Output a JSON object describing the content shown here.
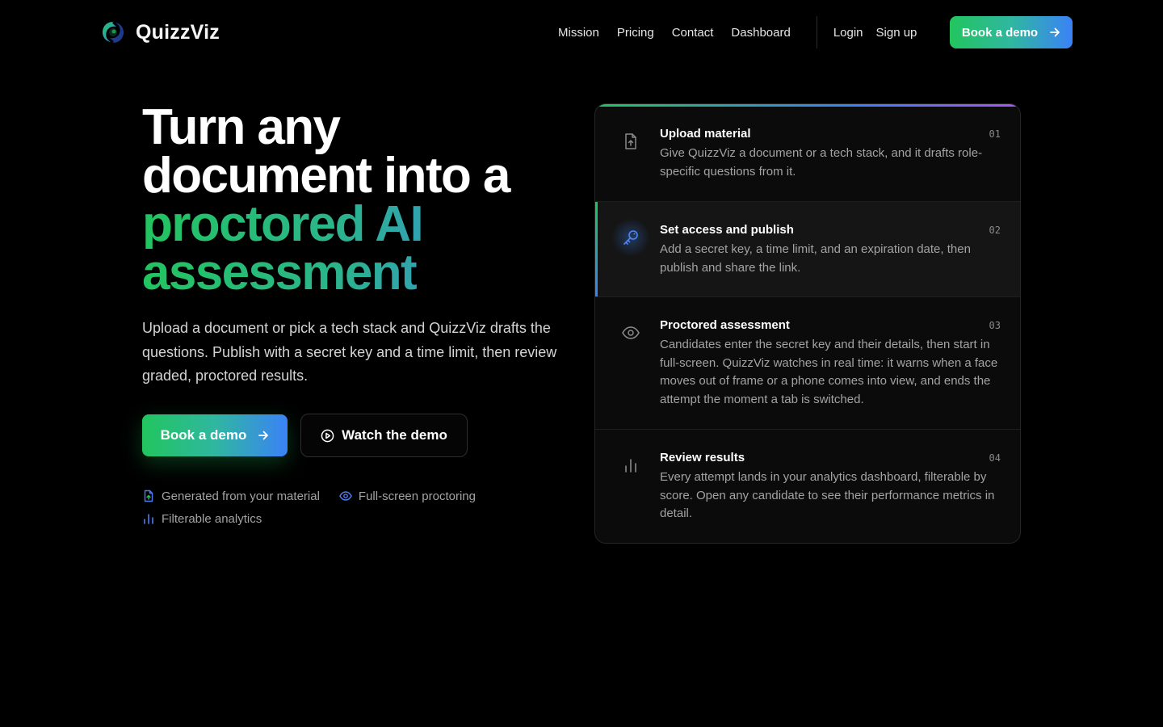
{
  "brand": {
    "name": "QuizzViz",
    "logo_icon": "swirl-logo-icon"
  },
  "nav": {
    "links": [
      "Mission",
      "Pricing",
      "Contact",
      "Dashboard"
    ],
    "login": "Login",
    "signup": "Sign up",
    "cta": "Book a demo"
  },
  "hero": {
    "title_line1": "Turn any",
    "title_line2": "document into a",
    "title_line3": "proctored AI",
    "title_line4": "assessment",
    "subtitle": "Upload a document or pick a tech stack and QuizzViz drafts the questions. Publish with a secret key and a time limit, then review graded, proctored results.",
    "primary_cta": "Book a demo",
    "secondary_cta": "Watch the demo",
    "features": [
      {
        "label": "Generated from your material",
        "icon": "file-upload-icon"
      },
      {
        "label": "Full-screen proctoring",
        "icon": "eye-icon"
      },
      {
        "label": "Filterable analytics",
        "icon": "bar-chart-icon"
      }
    ]
  },
  "steps": [
    {
      "num": "01",
      "title": "Upload material",
      "desc": "Give QuizzViz a document or a tech stack, and it drafts role-specific questions from it.",
      "icon": "file-upload-icon",
      "active": false
    },
    {
      "num": "02",
      "title": "Set access and publish",
      "desc": "Add a secret key, a time limit, and an expiration date, then publish and share the link.",
      "icon": "key-icon",
      "active": true
    },
    {
      "num": "03",
      "title": "Proctored assessment",
      "desc": "Candidates enter the secret key and their details, then start in full-screen. QuizzViz watches in real time: it warns when a face moves out of frame or a phone comes into view, and ends the attempt the moment a tab is switched.",
      "icon": "eye-icon",
      "active": false
    },
    {
      "num": "04",
      "title": "Review results",
      "desc": "Every attempt lands in your analytics dashboard, filterable by score. Open any candidate to see their performance metrics in detail.",
      "icon": "bar-chart-icon",
      "active": false
    }
  ],
  "colors": {
    "background": "#000000",
    "green": "#22c55e",
    "blue": "#3b82f6",
    "purple": "#a855f7"
  }
}
